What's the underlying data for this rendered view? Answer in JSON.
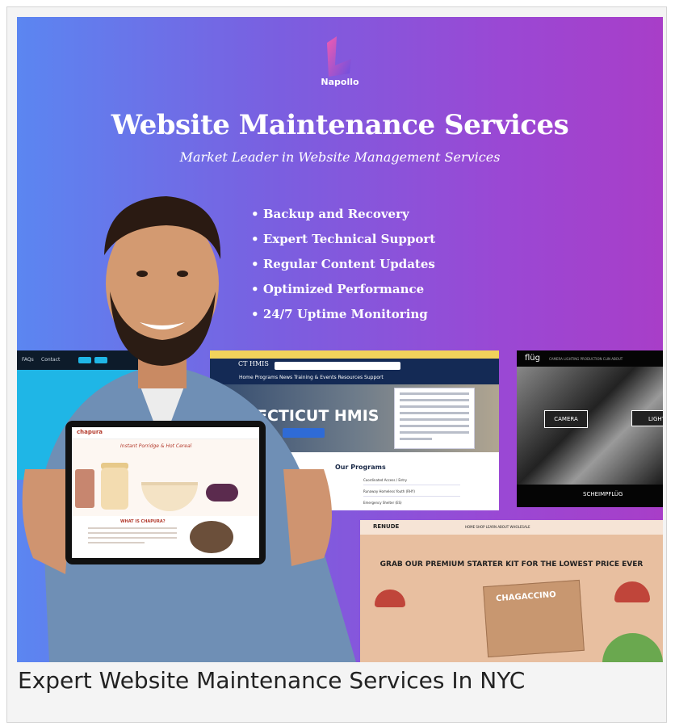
{
  "banner": {
    "logo_text": "Napollo",
    "title": "Website Maintenance  Services",
    "subtitle": "Market Leader in Website Management Services",
    "features": [
      "Backup and Recovery",
      "Expert Technical Support",
      "Regular Content Updates",
      "Optimized Performance",
      "24/7 Uptime Monitoring"
    ],
    "brand_colors": {
      "gradient_start": "#5b86f1",
      "gradient_end": "#a83ec8"
    }
  },
  "screenshots": {
    "left_nav": [
      "FAQs",
      "Contact"
    ],
    "ct": {
      "logo": "CT HMIS",
      "menu": "Home  Programs  News  Training & Events  Resources  Support",
      "hero_text": "ECTICUT HMIS",
      "programs_heading": "Our Programs",
      "program_rows": [
        "Coordinated Access / Entry",
        "Runaway Homeless Youth (RHY)",
        "Emergency Shelter (ES)"
      ]
    },
    "flug": {
      "logo": "flüg",
      "menu": "CAMERA  LIGHTING  PRODUCTION  CLIN  ABOUT",
      "camera_label": "CAMERA",
      "light_label": "LIGHT",
      "footer": "SCHEIMPFLÜG"
    },
    "renude": {
      "logo": "RENUDE",
      "menu": "HOME  SHOP  LEARN  ABOUT  WHOLESALE",
      "headline": "GRAB OUR PREMIUM STARTER KIT FOR THE LOWEST PRICE EVER",
      "box_text": "CHAGACCINO"
    },
    "tablet": {
      "logo": "chapura",
      "headline": "Instant Porridge & Hot Cereal",
      "section_title": "WHAT IS CHAPURA?"
    }
  },
  "caption": "Expert Website Maintenance Services In NYC"
}
